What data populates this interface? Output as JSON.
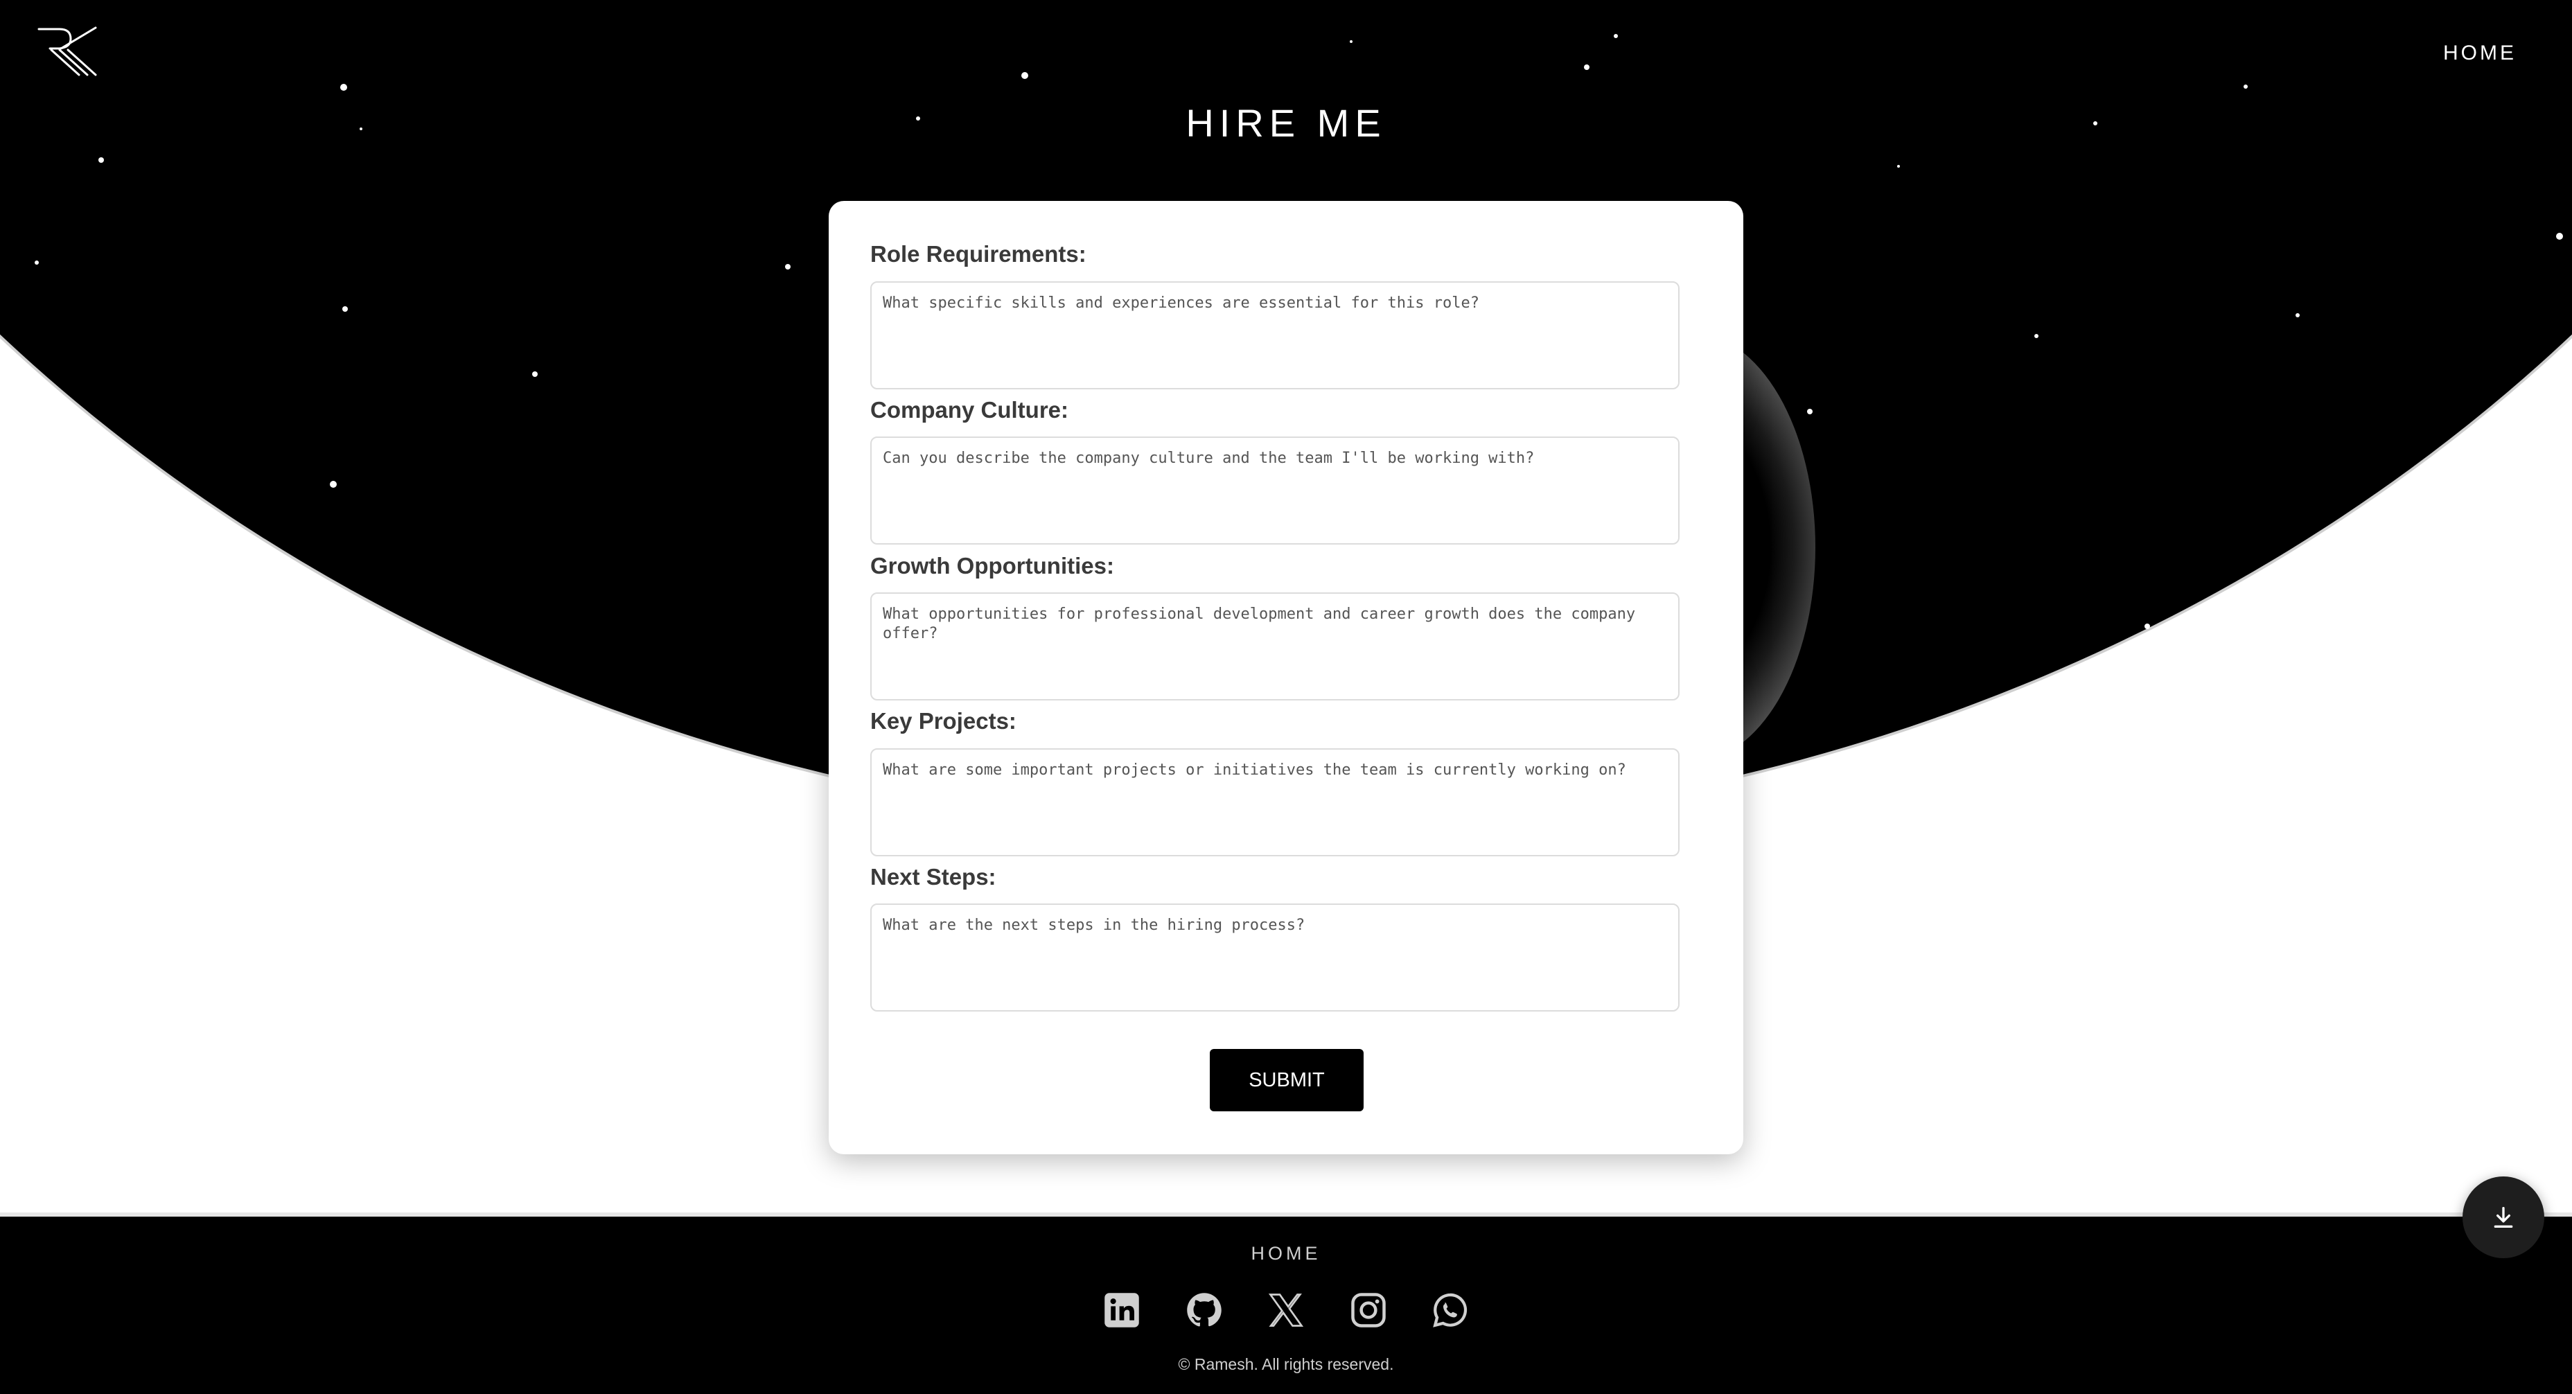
{
  "header": {
    "nav_home": "HOME",
    "logo_icon": "rk-monogram-logo-icon"
  },
  "page": {
    "title": "HIRE ME"
  },
  "form": {
    "fields": [
      {
        "label": "Role Requirements:",
        "placeholder": "What specific skills and experiences are essential for this role?",
        "value": ""
      },
      {
        "label": "Company Culture:",
        "placeholder": "Can you describe the company culture and the team I'll be working with?",
        "value": ""
      },
      {
        "label": "Growth Opportunities:",
        "placeholder": "What opportunities for professional development and career growth does the company offer?",
        "value": ""
      },
      {
        "label": "Key Projects:",
        "placeholder": "What are some important projects or initiatives the team is currently working on?",
        "value": ""
      },
      {
        "label": "Next Steps:",
        "placeholder": "What are the next steps in the hiring process?",
        "value": ""
      }
    ],
    "submit_label": "SUBMIT"
  },
  "footer": {
    "home_link": "HOME",
    "socials": [
      "linkedin-icon",
      "github-icon",
      "x-icon",
      "instagram-icon",
      "whatsapp-icon"
    ],
    "copyright": "© Ramesh. All rights reserved."
  },
  "fab": {
    "icon": "download-icon"
  },
  "colors": {
    "background": "#000000",
    "card": "#ffffff",
    "accent": "#000000",
    "footer_text": "#cfcfcf"
  }
}
